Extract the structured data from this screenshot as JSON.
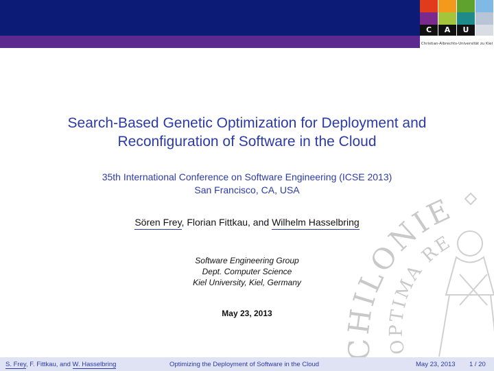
{
  "header": {
    "logo_letters": [
      "C",
      "A",
      "U"
    ],
    "university": "Christian-Albrechts-Universität zu Kiel",
    "colors": [
      "#e03c1c",
      "#f39a1d",
      "#5fa32e",
      "#7fb9e6",
      "#7a2a8c",
      "#a4c43b",
      "#1f8a8a",
      "#b8c5d6"
    ]
  },
  "slide": {
    "title_line1": "Search-Based Genetic Optimization for Deployment and",
    "title_line2": "Reconfiguration of Software in the Cloud",
    "conference_line1": "35th International Conference on Software Engineering (ICSE 2013)",
    "conference_line2": "San Francisco, CA, USA",
    "authors": {
      "author1": "Sören Frey",
      "sep1": ", Florian Fittkau, and ",
      "author3": "Wilhelm Hasselbring"
    },
    "institution_line1": "Software Engineering Group",
    "institution_line2": "Dept. Computer Science",
    "institution_line3": "Kiel University, Kiel, Germany",
    "date": "May 23, 2013",
    "seal_text_outer": "CHILONIENSIS",
    "seal_text_inner": "OPTIMA RERUM"
  },
  "footer": {
    "author1": "S. Frey",
    "authors_mid": ", F. Fittkau, and ",
    "author3": "W. Hasselbring",
    "title": "Optimizing the Deployment of Software in the Cloud",
    "date": "May 23, 2013",
    "page": "1 / 20"
  }
}
